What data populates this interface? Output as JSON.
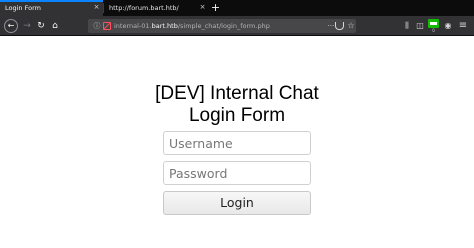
{
  "browser": {
    "tabs": [
      {
        "title": "Login Form",
        "active": true
      },
      {
        "title": "http://forum.bart.htb/",
        "active": false
      }
    ],
    "newtab_label": "+",
    "close_label": "×",
    "url_prefix": "internal-01.",
    "url_host": "bart.htb",
    "url_path": "/simple_chat/login_form.php",
    "extension_badge": "0",
    "icons": {
      "back": "back-arrow-icon",
      "forward": "forward-arrow-icon",
      "reload": "reload-icon",
      "home": "home-icon",
      "info": "info-icon",
      "insecure_lock": "insecure-lock-icon",
      "more": "page-actions-icon",
      "pocket": "pocket-icon",
      "bookmark": "star-icon",
      "library": "library-icon",
      "sidebar": "sidebar-icon",
      "extension": "extension-icon",
      "account": "account-icon",
      "menu": "hamburger-menu-icon"
    },
    "colors": {
      "tabstrip": "#0c0c0d",
      "toolbar": "#323234",
      "urlbar": "#474749",
      "accent": "#0a84ff",
      "insecure": "#ff4f5e",
      "extension": "#12bc00"
    }
  },
  "page": {
    "title_line1": "[DEV] Internal Chat",
    "title_line2": "Login Form",
    "username_placeholder": "Username",
    "username_value": "",
    "password_placeholder": "Password",
    "password_value": "",
    "login_label": "Login"
  }
}
